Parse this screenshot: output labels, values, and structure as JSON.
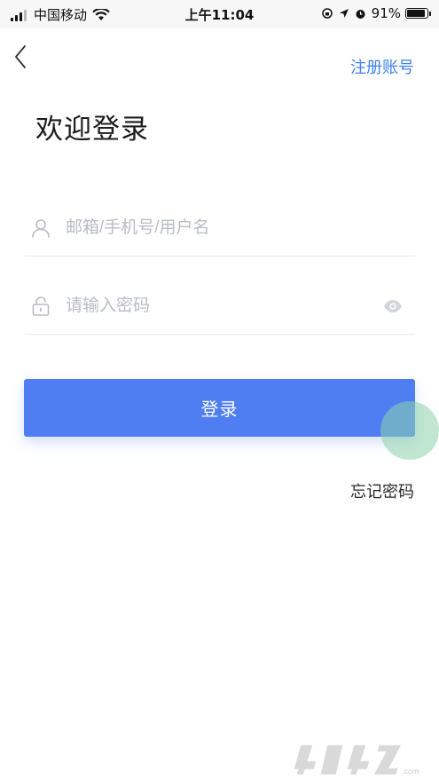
{
  "status_bar": {
    "carrier": "中国移动",
    "time": "上午11:04",
    "battery_percent": "91%",
    "battery_level": 0.91
  },
  "header": {
    "back_icon": "chevron-left-icon",
    "register_label": "注册账号"
  },
  "title": "欢迎登录",
  "form": {
    "username_placeholder": "邮箱/手机号/用户名",
    "username_value": "",
    "password_placeholder": "请输入密码",
    "password_value": "",
    "login_label": "登录",
    "forgot_label": "忘记密码"
  },
  "colors": {
    "accent": "#4f7ef3",
    "link": "#3f80ee",
    "placeholder": "#b9bcc6"
  },
  "watermark_text": "4U4Z.com"
}
